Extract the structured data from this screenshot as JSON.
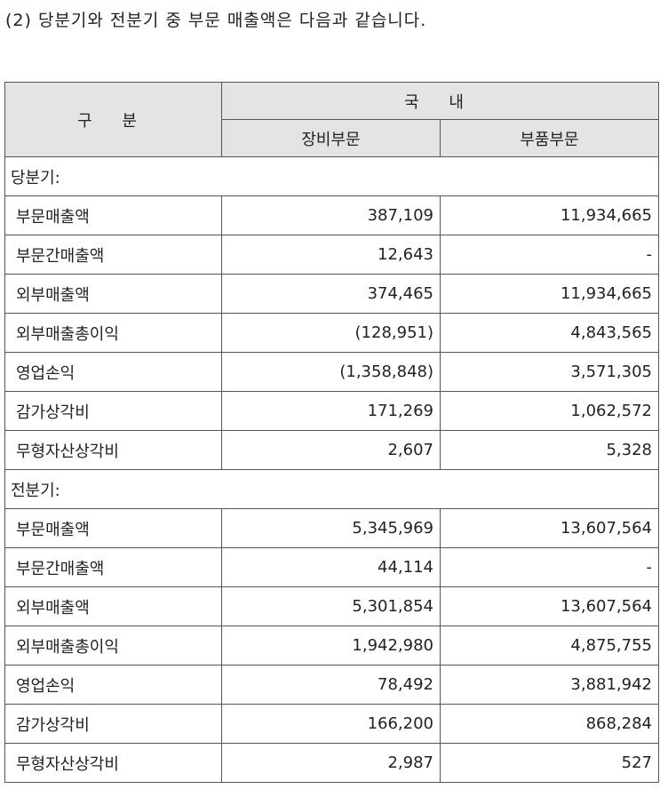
{
  "title": "(2) 당분기와 전분기 중 부문 매출액은 다음과 같습니다.",
  "header": {
    "category": "구  분",
    "domestic": "국  내",
    "col1": "장비부문",
    "col2": "부품부문"
  },
  "sections": [
    {
      "label": "당분기:",
      "rows": [
        {
          "item": "부문매출액",
          "v1": "387,109",
          "v2": "11,934,665"
        },
        {
          "item": "부문간매출액",
          "v1": "12,643",
          "v2": "-"
        },
        {
          "item": "외부매출액",
          "v1": "374,465",
          "v2": "11,934,665"
        },
        {
          "item": "외부매출총이익",
          "v1": "(128,951)",
          "v2": "4,843,565"
        },
        {
          "item": "영업손익",
          "v1": "(1,358,848)",
          "v2": "3,571,305"
        },
        {
          "item": "감가상각비",
          "v1": "171,269",
          "v2": "1,062,572"
        },
        {
          "item": "무형자산상각비",
          "v1": "2,607",
          "v2": "5,328"
        }
      ]
    },
    {
      "label": "전분기:",
      "rows": [
        {
          "item": "부문매출액",
          "v1": "5,345,969",
          "v2": "13,607,564"
        },
        {
          "item": "부문간매출액",
          "v1": "44,114",
          "v2": "-"
        },
        {
          "item": "외부매출액",
          "v1": "5,301,854",
          "v2": "13,607,564"
        },
        {
          "item": "외부매출총이익",
          "v1": "1,942,980",
          "v2": "4,875,755"
        },
        {
          "item": "영업손익",
          "v1": "78,492",
          "v2": "3,881,942"
        },
        {
          "item": "감가상각비",
          "v1": "166,200",
          "v2": "868,284"
        },
        {
          "item": "무형자산상각비",
          "v1": "2,987",
          "v2": "527"
        }
      ]
    }
  ]
}
